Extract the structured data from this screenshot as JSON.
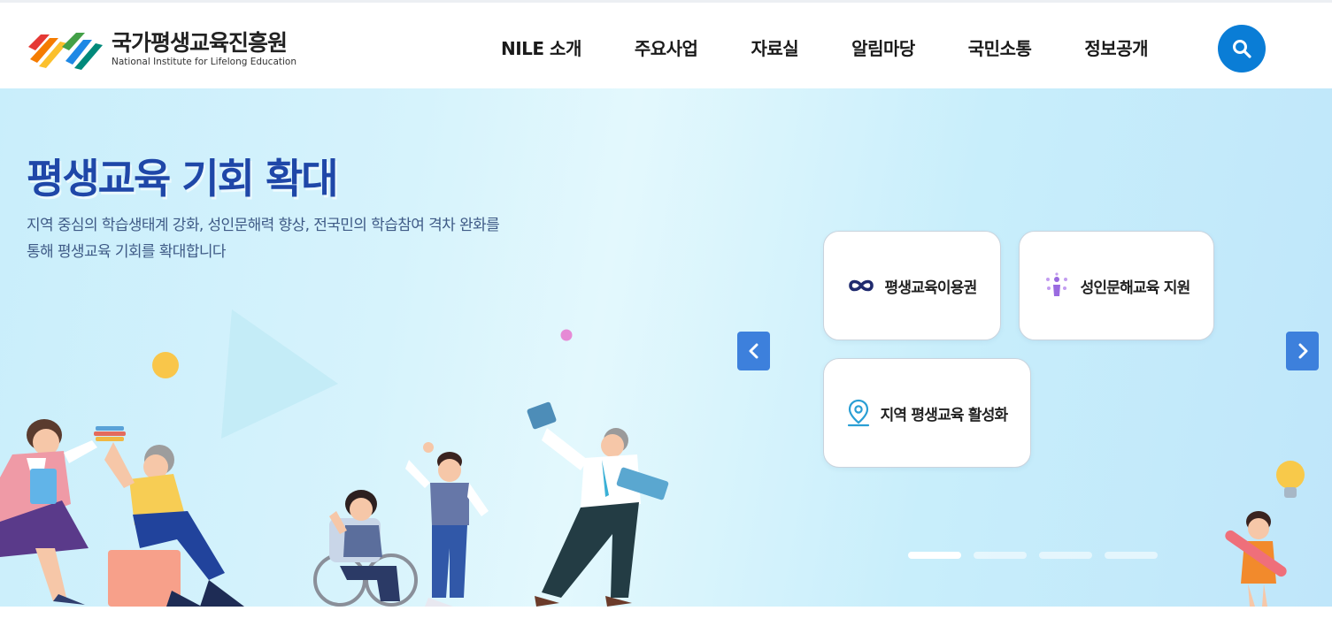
{
  "header": {
    "logo_kr": "국가평생교육진흥원",
    "logo_en": "National Institute for Lifelong Education",
    "nav": [
      "NILE 소개",
      "주요사업",
      "자료실",
      "알림마당",
      "국민소통",
      "정보공개"
    ]
  },
  "colors": {
    "brand_blue": "#0a7dd6",
    "title_blue": "#1f47a8",
    "arrow_blue": "#3d80dc"
  },
  "hero": {
    "title": "평생교육 기회 확대",
    "desc_line1": "지역 중심의 학습생태계 강화, 성인문해력 향상, 전국민의 학습참여 격차 완화를",
    "desc_line2": "통해 평생교육 기회를 확대합니다",
    "cards": [
      {
        "label": "평생교육이용권",
        "icon": "infinity-icon"
      },
      {
        "label": "성인문해교육 지원",
        "icon": "literacy-icon"
      },
      {
        "label": "지역 평생교육 활성화",
        "icon": "location-pin-icon"
      }
    ],
    "slides": {
      "count": 4,
      "active": 1
    }
  }
}
